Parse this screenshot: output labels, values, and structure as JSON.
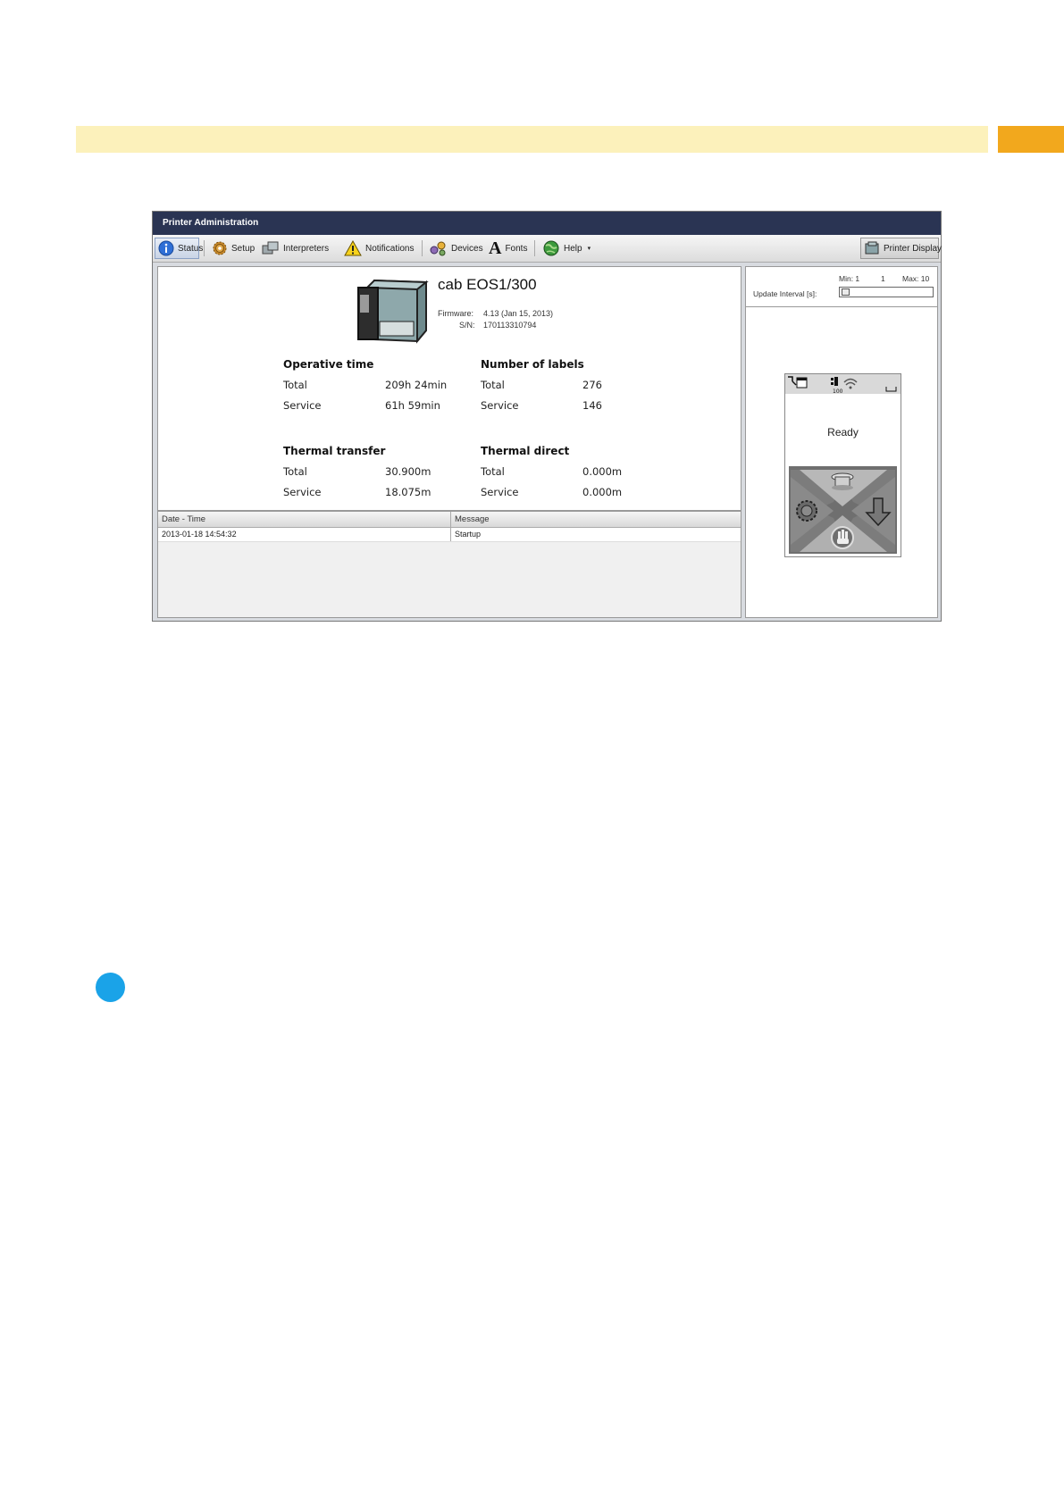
{
  "window": {
    "title": "Printer Administration"
  },
  "toolbar": {
    "status": "Status",
    "setup": "Setup",
    "interpreters": "Interpreters",
    "notifications": "Notifications",
    "devices": "Devices",
    "fonts": "Fonts",
    "help": "Help",
    "help_caret": "▾",
    "printer_display": "Printer Display"
  },
  "printer": {
    "model": "cab EOS1/300",
    "firmware_label": "Firmware:",
    "firmware_value": "4.13 (Jan 15, 2013)",
    "sn_label": "S/N:",
    "sn_value": "170113310794"
  },
  "stats": {
    "operative_time": {
      "title": "Operative time",
      "total_label": "Total",
      "total": "209h 24min",
      "service_label": "Service",
      "service": "61h 59min"
    },
    "labels": {
      "title": "Number of labels",
      "total_label": "Total",
      "total": "276",
      "service_label": "Service",
      "service": "146"
    },
    "thermal_transfer": {
      "title": "Thermal transfer",
      "total_label": "Total",
      "total": "30.900m",
      "service_label": "Service",
      "service": "18.075m"
    },
    "thermal_direct": {
      "title": "Thermal direct",
      "total_label": "Total",
      "total": "0.000m",
      "service_label": "Service",
      "service": "0.000m"
    }
  },
  "log": {
    "columns": [
      "Date - Time",
      "Message"
    ],
    "rows": [
      {
        "datetime": "2013-01-18 14:54:32",
        "message": "Startup"
      }
    ]
  },
  "update_interval": {
    "label": "Update Interval [s]:",
    "min": "Min: 1",
    "current": "1",
    "max": "Max: 10",
    "value": 1
  },
  "display": {
    "status_text": "Ready",
    "status_icons_number": "100"
  },
  "colors": {
    "header_bar": "#fcf1bb",
    "header_tab": "#f2a81d",
    "titlebar": "#2a3453",
    "info_dot": "#1aa3e8"
  },
  "icons": [
    "info-icon",
    "gear-icon",
    "printers-icon",
    "warning-icon",
    "devices-icon",
    "font-icon",
    "help-globe-icon",
    "printer-display-icon"
  ]
}
